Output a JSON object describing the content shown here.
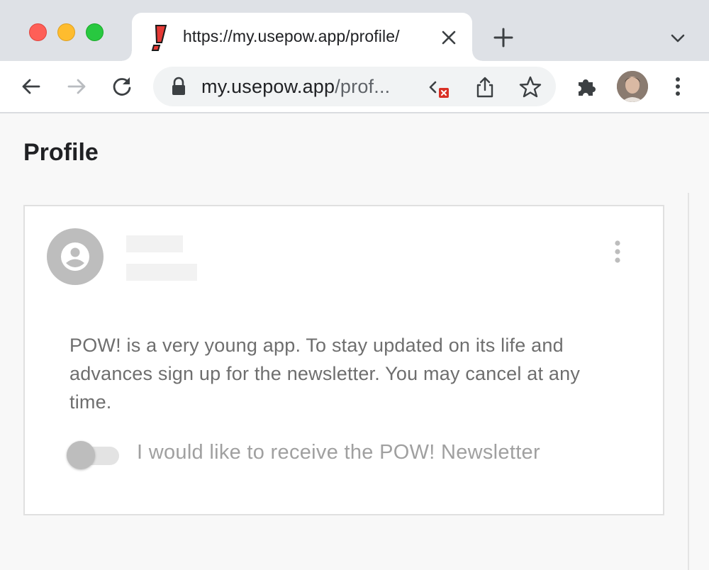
{
  "browser": {
    "tab": {
      "title": "https://my.usepow.app/profile/",
      "favicon": "pow-exclamation-icon"
    },
    "address_bar": {
      "host": "my.usepow.app",
      "path": "/prof..."
    },
    "colors": {
      "close": "#fe5f57",
      "minimize": "#febc2e",
      "zoom": "#28c840"
    }
  },
  "page": {
    "title": "Profile",
    "card": {
      "description": "POW! is a very young app. To stay updated on its life and advances sign up for the newsletter. You may cancel at any time.",
      "newsletter": {
        "label": "I would like to receive the POW! Newsletter",
        "checked": false
      }
    }
  }
}
